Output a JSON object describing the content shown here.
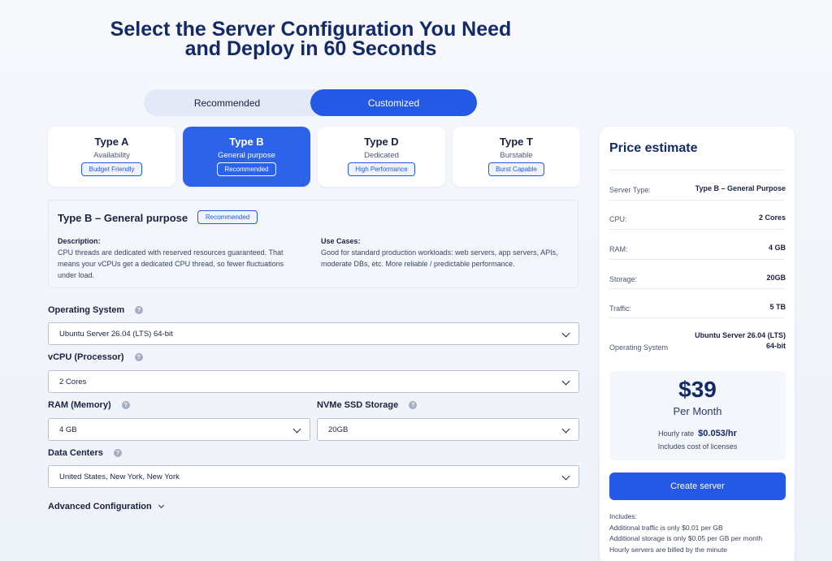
{
  "headline": {
    "line1": "Select the Server Configuration You Need",
    "line2": "and Deploy in 60 Seconds"
  },
  "mode_toggle": {
    "options": [
      "Recommended",
      "Customized"
    ],
    "selected": "Customized"
  },
  "server_types": [
    {
      "name": "Type A",
      "subtitle": "Availability",
      "badge": "Budget Friendly",
      "selected": false
    },
    {
      "name": "Type B",
      "subtitle": "General purpose",
      "badge": "Recommended",
      "selected": true
    },
    {
      "name": "Type D",
      "subtitle": "Dedicated",
      "badge": "High Performance",
      "selected": false
    },
    {
      "name": "Type T",
      "subtitle": "Burstable",
      "badge": "Burst Capable",
      "selected": false
    }
  ],
  "type_details": {
    "title": "Type B – General purpose",
    "badge": "Recommended",
    "description_label": "Description:",
    "description_text": "CPU threads are dedicated with reserved resources guaranteed. That means your vCPUs get a dedicated CPU thread, so fewer fluctuations under load.",
    "use_cases_label": "Use Cases:",
    "use_cases_text": "Good for standard production workloads: web servers, app servers, APIs, moderate DBs, etc. More reliable / predictable performance."
  },
  "form": {
    "os_label": "Operating System",
    "os_value": "Ubuntu Server 26.04 (LTS) 64-bit",
    "vcpu_label": "vCPU (Processor)",
    "vcpu_value": "2 Cores",
    "ram_label": "RAM (Memory)",
    "ram_value": "4 GB",
    "storage_label": "NVMe SSD Storage",
    "storage_value": "20GB",
    "dc_label": "Data Centers",
    "dc_value": "United States, New York, New York",
    "help_glyph": "?",
    "advanced_label": "Advanced Configuration"
  },
  "price_estimate": {
    "title": "Price estimate",
    "rows": [
      {
        "label": "Server Type:",
        "value": "Type B – General Purpose"
      },
      {
        "label": "CPU:",
        "value": "2 Cores"
      },
      {
        "label": "RAM:",
        "value": "4 GB"
      },
      {
        "label": "Storage:",
        "value": "20GB"
      },
      {
        "label": "Traffic:",
        "value": "5 TB"
      },
      {
        "label": "Operating System",
        "value_line1": "Ubuntu Server 26.04 (LTS)",
        "value_line2": "64-bit"
      }
    ],
    "price": "$39",
    "period": "Per Month",
    "hourly_label": "Hourly rate",
    "hourly_value": "$0.053/hr",
    "licenses_note": "Includes cost of licenses",
    "create_button": "Create server",
    "includes_title": "Includes:",
    "includes": [
      "Additional traffic is only $0.01 per GB",
      "Additional storage is only $0.05 per GB per month",
      "Hourly servers are billed by the minute"
    ]
  },
  "colors": {
    "accent": "#2459e6",
    "heading": "#142a66",
    "background": "#f3f6fb"
  }
}
